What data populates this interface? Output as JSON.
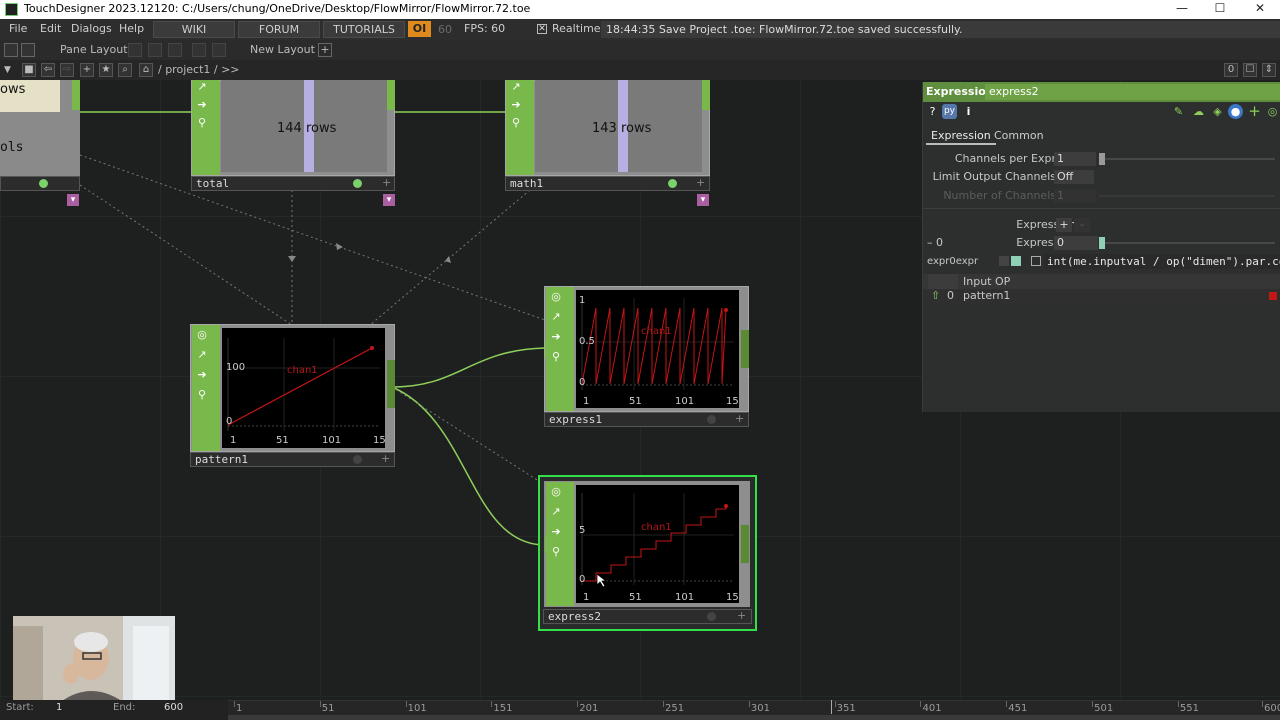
{
  "window": {
    "title": "TouchDesigner 2023.12120: C:/Users/chung/OneDrive/Desktop/FlowMirror/FlowMirror.72.toe",
    "minimize": "—",
    "maximize": "☐",
    "close": "✕"
  },
  "menu": {
    "items": [
      "File",
      "Edit",
      "Dialogs",
      "Help"
    ],
    "buttons": [
      "WIKI",
      "FORUM",
      "TUTORIALS"
    ],
    "oi": "OI",
    "sixty": "60",
    "fps": "FPS:  60",
    "realtime_check": "✕",
    "realtime_label": "Realtime",
    "status": "18:44:35 Save Project .toe: FlowMirror.72.toe saved successfully."
  },
  "panebar": {
    "pane_layout": "Pane Layout",
    "new_layout": "New Layout",
    "plus": "+"
  },
  "pathbar": {
    "path": "/ project1 / >>",
    "counter": "0"
  },
  "nodes": {
    "left_partial": {
      "rows_fragment": "ows",
      "cols_fragment": "ols"
    },
    "total": {
      "name": "total",
      "rows": "144 rows"
    },
    "math1": {
      "name": "math1",
      "rows": "143 rows"
    },
    "pattern1": {
      "name": "pattern1",
      "chan": "chan1",
      "yticks": [
        "100",
        "0"
      ],
      "xticks": [
        "1",
        "51",
        "101",
        "15"
      ]
    },
    "express1": {
      "name": "express1",
      "chan": "chan1",
      "yticks": [
        "1",
        "0.5",
        "0"
      ],
      "xticks": [
        "1",
        "51",
        "101",
        "15"
      ]
    },
    "express2": {
      "name": "express2",
      "chan": "chan1",
      "yticks": [
        "5",
        "0"
      ],
      "xticks": [
        "1",
        "51",
        "101",
        "15"
      ]
    }
  },
  "params": {
    "type": "Expression",
    "name": "express2",
    "tabs": [
      "Expression",
      "Common"
    ],
    "channels_per_expr_label": "Channels per Expr",
    "channels_per_expr_value": "1",
    "limit_output_label": "Limit Output Channels",
    "limit_output_value": "Off",
    "num_channels_label": "Number of Channels",
    "num_channels_value": "1",
    "expression_header": "Expression",
    "expression_plus": "+",
    "expression_minus": "-",
    "expr_index_label": "– 0",
    "expression_label": "Expression",
    "expression_value": "0",
    "expr0expr_label": "expr0expr",
    "expr0expr_value": "int(me.inputval / op(\"dimen\").par.co",
    "input_op_header": "Input OP",
    "input_op_index": "0",
    "input_op_value": "pattern1"
  },
  "timeline": {
    "start_label": "Start:",
    "start_value": "1",
    "end_label": "End:",
    "end_value": "600",
    "ticks": [
      "1",
      "51",
      "101",
      "151",
      "201",
      "251",
      "301",
      "351",
      "401",
      "451",
      "501",
      "551",
      "600"
    ]
  },
  "colors": {
    "op_green": "#79b84a",
    "select_green": "#33e04a",
    "param_header": "#5f8f3e",
    "curve_red": "#c41616",
    "oi_orange": "#e08a1e"
  }
}
